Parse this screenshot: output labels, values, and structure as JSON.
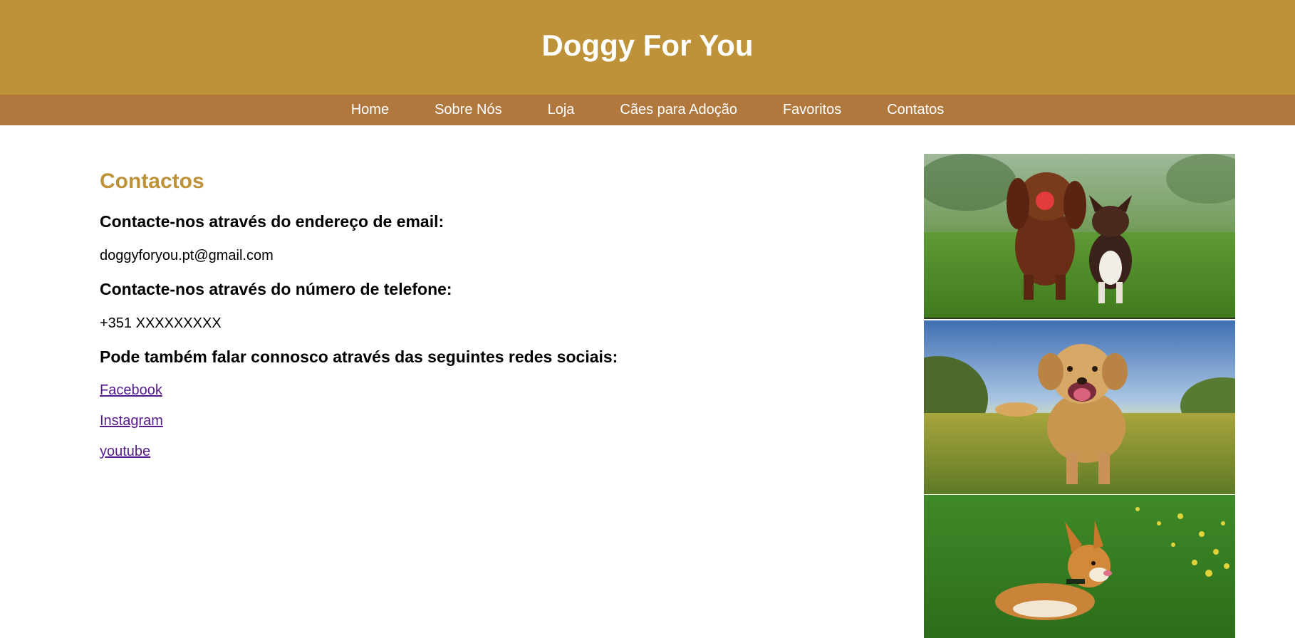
{
  "header": {
    "title": "Doggy For You"
  },
  "nav": {
    "items": [
      {
        "label": "Home"
      },
      {
        "label": "Sobre Nós"
      },
      {
        "label": "Loja"
      },
      {
        "label": "Cães para Adoção"
      },
      {
        "label": "Favoritos"
      },
      {
        "label": "Contatos"
      }
    ]
  },
  "main": {
    "title": "Contactos",
    "email_heading": "Contacte-nos através do endereço de email:",
    "email": "doggyforyou.pt@gmail.com",
    "phone_heading": "Contacte-nos através do número de telefone:",
    "phone": "+351 XXXXXXXXX",
    "social_heading": "Pode também falar connosco através das seguintes redes sociais:",
    "social_links": [
      {
        "label": "Facebook"
      },
      {
        "label": "Instagram"
      },
      {
        "label": "youtube"
      }
    ]
  },
  "colors": {
    "header_bg": "#bd9238",
    "nav_bg": "#b1783e",
    "accent": "#bd9238",
    "link_visited": "#551a8b"
  },
  "images": [
    {
      "icon": "two-dogs-running-photo"
    },
    {
      "icon": "golden-retriever-running-photo"
    },
    {
      "icon": "corgi-in-grass-photo"
    }
  ]
}
